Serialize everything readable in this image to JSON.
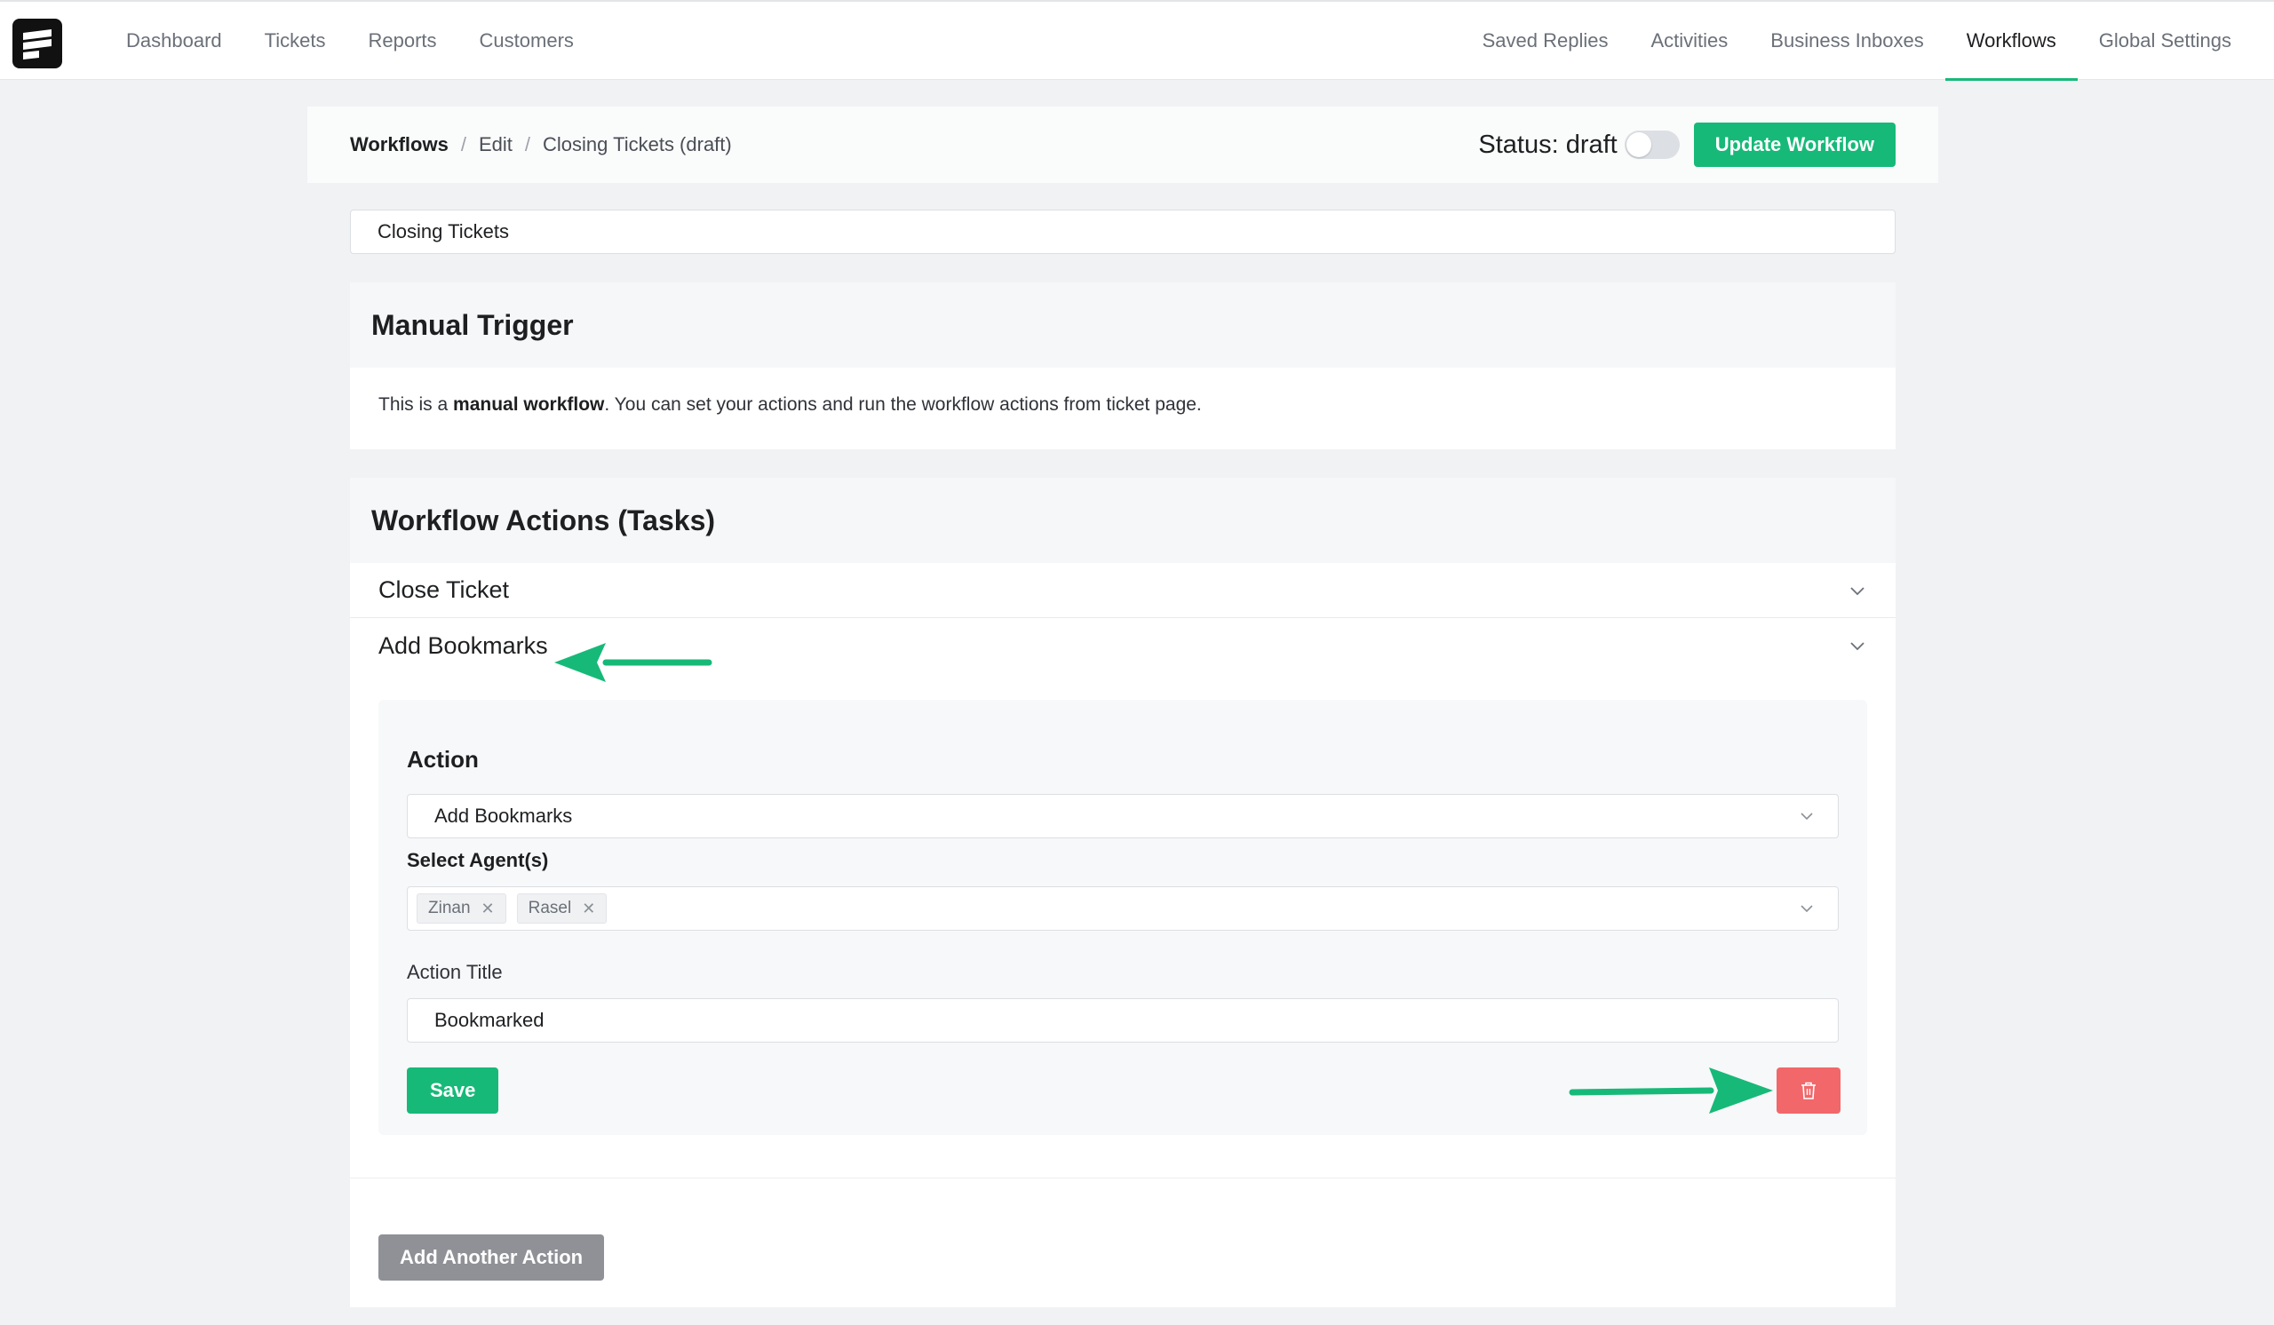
{
  "nav": {
    "left": [
      "Dashboard",
      "Tickets",
      "Reports",
      "Customers"
    ],
    "right": [
      "Saved Replies",
      "Activities",
      "Business Inboxes",
      "Workflows",
      "Global Settings"
    ],
    "active": "Workflows"
  },
  "breadcrumb": {
    "root": "Workflows",
    "sep": "/",
    "edit": "Edit",
    "current": "Closing Tickets (draft)"
  },
  "header": {
    "status_label": "Status: draft",
    "status_enabled": false,
    "update_button": "Update Workflow"
  },
  "workflow_title": {
    "value": "Closing Tickets"
  },
  "trigger": {
    "heading": "Manual Trigger",
    "text_before": "This is a ",
    "text_bold": "manual workflow",
    "text_after": ". You can set your actions and run the workflow actions from ticket page."
  },
  "actions": {
    "heading": "Workflow Actions (Tasks)",
    "items": [
      {
        "title": "Close Ticket"
      },
      {
        "title": "Add Bookmarks"
      }
    ],
    "panel": {
      "heading": "Action",
      "action_select": "Add Bookmarks",
      "agents_label": "Select Agent(s)",
      "agents": [
        "Zinan",
        "Rasel"
      ],
      "title_label": "Action Title",
      "title_value": "Bookmarked",
      "save_button": "Save"
    },
    "add_button": "Add Another Action"
  },
  "icons": {
    "logo": "brand-logo-icon",
    "chevron": "chevron-down-icon",
    "delete": "trash-icon",
    "remove_tag": "close-icon",
    "annotation": "arrow-icon"
  },
  "colors": {
    "accent": "#17b978",
    "danger": "#f1676a",
    "secondary": "#8f9196",
    "arrow": "#17b978"
  }
}
